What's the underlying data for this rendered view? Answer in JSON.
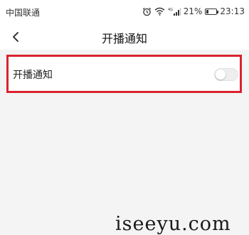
{
  "status_bar": {
    "carrier": "中国联通",
    "battery": "21%",
    "battery_level": 0.21,
    "time": "23:13",
    "signal_label": "4G",
    "icons": [
      "alarm-icon",
      "wifi-icon",
      "signal-icon",
      "battery-icon"
    ]
  },
  "nav": {
    "back_icon": "chevron-left-icon",
    "title": "开播通知"
  },
  "settings": {
    "item_label": "开播通知",
    "toggle_on": false
  },
  "watermark": "iseeyu.com",
  "colors": {
    "highlight": "#d9232e",
    "background": "#f4f4f4",
    "surface": "#ffffff"
  }
}
